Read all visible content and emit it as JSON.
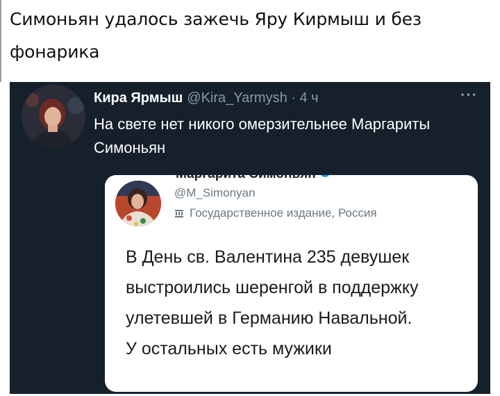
{
  "caption": "Симоньян удалось зажечь Яру Кирмыш и без фонарика",
  "tweet": {
    "author_name": "Кира Ярмыш",
    "author_meta": "@Kira_Yarmysh · 4 ч",
    "more_icon": "more-horizontal-icon",
    "text": "На свете нет никого омерзительнее Маргариты Симоньян"
  },
  "quoted": {
    "name_partial": "Маргарита Симоньян",
    "handle": "@M_Simonyan",
    "state_label": "Государственное издание, Россия",
    "text": "В День св. Валентина 235 девушек выстроились шеренгой в поддержку улетевшей в Германию Навальной.",
    "text_cut": "У остальных есть мужики"
  },
  "colors": {
    "dark_bg": "#15202b",
    "muted": "#8899a6",
    "verified": "#1da1f2"
  }
}
